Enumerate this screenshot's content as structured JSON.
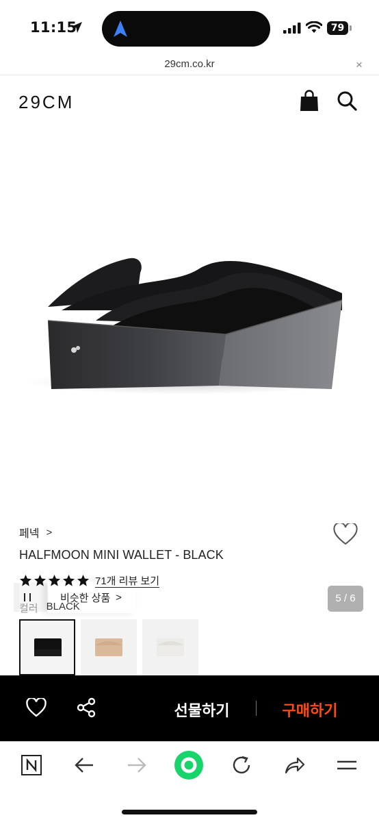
{
  "status_bar": {
    "time": "11:15",
    "battery_level": "79"
  },
  "url_bar": {
    "url": "29cm.co.kr",
    "close_glyph": "×"
  },
  "header": {
    "logo": "29CM",
    "icons": [
      "bag-icon",
      "search-icon"
    ]
  },
  "gallery": {
    "similar_products_label": "비슷한 상품",
    "page_indicator": "5 / 6",
    "chevron": ">"
  },
  "product": {
    "brand": "페넥",
    "brand_chevron": ">",
    "name": "HALFMOON MINI WALLET - BLACK",
    "rating_stars": 5,
    "review_link": "71개 리뷰 보기",
    "color_label": "컬러",
    "color_value": "BLACK",
    "color_options": [
      "black",
      "beige",
      "ivory"
    ]
  },
  "action_bar": {
    "gift_label": "선물하기",
    "buy_label": "구매하기",
    "buy_color": "#ff4a1a"
  },
  "browser_toolbar": {
    "icons": [
      "naver-n-icon",
      "back-arrow-icon",
      "forward-arrow-icon",
      "green-home-icon",
      "reload-icon",
      "share-arrow-icon",
      "menu-icon"
    ]
  }
}
